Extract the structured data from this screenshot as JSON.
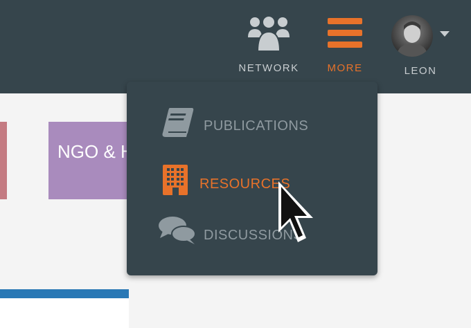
{
  "nav": {
    "network_label": "NETWORK",
    "more_label": "MORE",
    "user_label": "LEON",
    "icons": {
      "network": "users-group-icon",
      "more": "hamburger-menu-icon",
      "user": "avatar",
      "caret": "caret-down-icon"
    }
  },
  "cards": {
    "ngo_label": "NGO & H"
  },
  "dropdown": {
    "items": [
      {
        "label": "PUBLICATIONS",
        "icon": "book-icon",
        "active": false
      },
      {
        "label": "RESOURCES",
        "icon": "building-icon",
        "active": true
      },
      {
        "label": "DISCUSSIONS",
        "icon": "speech-bubbles-icon",
        "active": false
      }
    ]
  },
  "colors": {
    "topbar": "#36454c",
    "accent": "#e8722a",
    "muted_text": "#8f9aa0",
    "nav_text": "#c8cdd0",
    "card_pink": "#c47b82",
    "card_purple": "#a98bbd",
    "panel_border": "#2978b5",
    "background": "#f4f4f4"
  }
}
